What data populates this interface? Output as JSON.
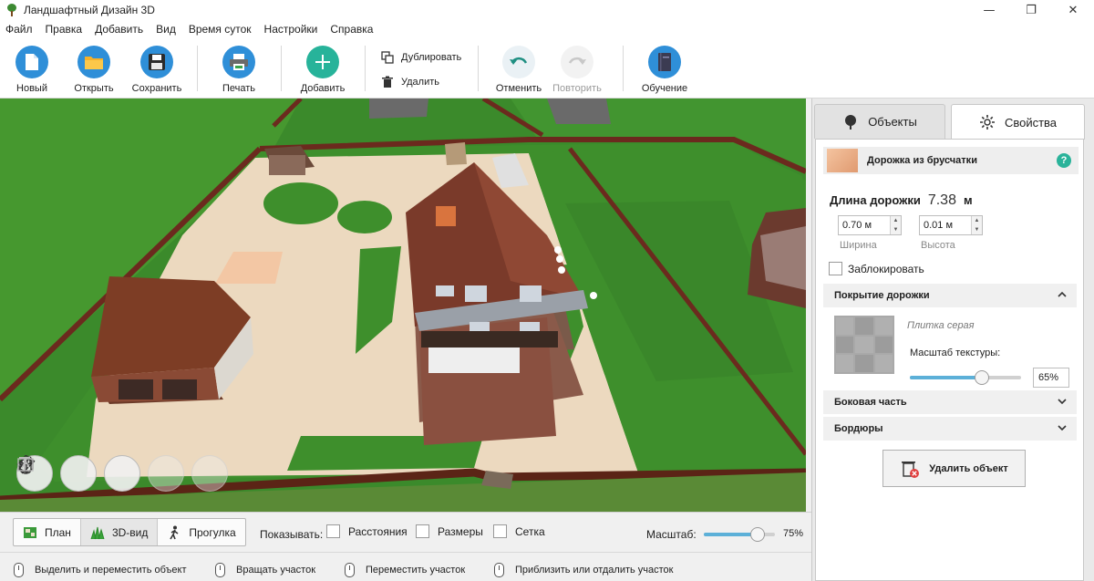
{
  "window": {
    "title": "Ландшафтный Дизайн 3D",
    "controls": [
      "—",
      "❐",
      "✕"
    ]
  },
  "menu": [
    "Файл",
    "Правка",
    "Добавить",
    "Вид",
    "Время суток",
    "Настройки",
    "Справка"
  ],
  "toolbar": {
    "new_label": "Новый",
    "open_label": "Открыть",
    "save_label": "Сохранить",
    "print_label": "Печать",
    "add_label": "Добавить",
    "duplicate_label": "Дублировать",
    "delete_label": "Удалить",
    "undo_label": "Отменить",
    "redo_label": "Повторить",
    "tutorial_label": "Обучение"
  },
  "view_bar": {
    "tabs": [
      {
        "label": "План",
        "active": false
      },
      {
        "label": "3D-вид",
        "active": true
      },
      {
        "label": "Прогулка",
        "active": false
      }
    ],
    "show_label": "Показывать:",
    "checkboxes": [
      {
        "label": "Расстояния",
        "checked": false
      },
      {
        "label": "Размеры",
        "checked": false
      },
      {
        "label": "Сетка",
        "checked": false
      }
    ],
    "zoom_label": "Масштаб:",
    "zoom_value": "75%",
    "zoom_fraction": 0.75
  },
  "status_hints": [
    "Выделить и переместить объект",
    "Вращать участок",
    "Переместить участок",
    "Приблизить или отдалить участок"
  ],
  "panel": {
    "tabs": {
      "objects": "Объекты",
      "properties": "Свойства",
      "active": "properties"
    },
    "object_name": "Дорожка из брусчатки",
    "help": "?",
    "length_label": "Длина дорожки",
    "length_value": "7.38",
    "length_unit": "м",
    "width_value": "0.70 м",
    "width_caption": "Ширина",
    "height_value": "0.01 м",
    "height_caption": "Высота",
    "lock_label": "Заблокировать",
    "lock_checked": false,
    "sections": {
      "surface": "Покрытие дорожки",
      "side": "Боковая часть",
      "borders": "Бордюры"
    },
    "texture_name": "Плитка серая",
    "texture_scale_label": "Масштаб текстуры:",
    "texture_scale_value": "65%",
    "texture_scale_fraction": 0.65,
    "delete_object_label": "Удалить объект"
  },
  "colors": {
    "accent": "#5cb0d8",
    "grass": "#3a8a2a",
    "path": "#efdcc2",
    "roof": "#7a3020",
    "help": "#2ab39a"
  }
}
